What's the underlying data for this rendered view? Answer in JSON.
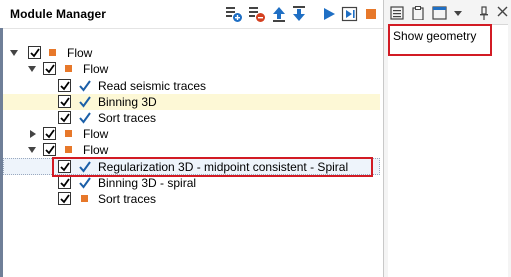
{
  "panel": {
    "title": "Module Manager"
  },
  "toolbar": {
    "icons": [
      "add-module-icon",
      "remove-module-icon",
      "move-up-icon",
      "move-down-icon",
      "run-icon",
      "run-step-icon",
      "stop-icon",
      "view-list-icon",
      "clipboard-icon",
      "window-layout-icon",
      "dropdown-icon",
      "pin-icon",
      "close-icon"
    ]
  },
  "tree": {
    "items": [
      {
        "label": "Flow",
        "type": "flow",
        "checked": true,
        "expanded": true
      },
      {
        "label": "Flow",
        "type": "flow",
        "checked": true,
        "expanded": true
      },
      {
        "label": "Read seismic traces",
        "type": "module-done",
        "checked": true
      },
      {
        "label": "Binning 3D",
        "type": "module-done",
        "checked": true,
        "highlighted": true
      },
      {
        "label": "Sort traces",
        "type": "module-done",
        "checked": true
      },
      {
        "label": "Flow",
        "type": "flow",
        "checked": true,
        "expanded": false
      },
      {
        "label": "Flow",
        "type": "flow",
        "checked": true,
        "expanded": true
      },
      {
        "label": "Regularization 3D - midpoint consistent - Spiral",
        "type": "module-done",
        "checked": true,
        "selected": true
      },
      {
        "label": "Binning 3D - spiral",
        "type": "module-done",
        "checked": true
      },
      {
        "label": "Sort traces",
        "type": "module-pending",
        "checked": true
      }
    ]
  },
  "right_panel": {
    "show_geometry_label": "Show geometry"
  },
  "colors": {
    "module_orange": "#e7782a",
    "check_blue": "#1b5fa8",
    "annotation_red": "#d21b24",
    "highlight": "#fdf8d6"
  }
}
